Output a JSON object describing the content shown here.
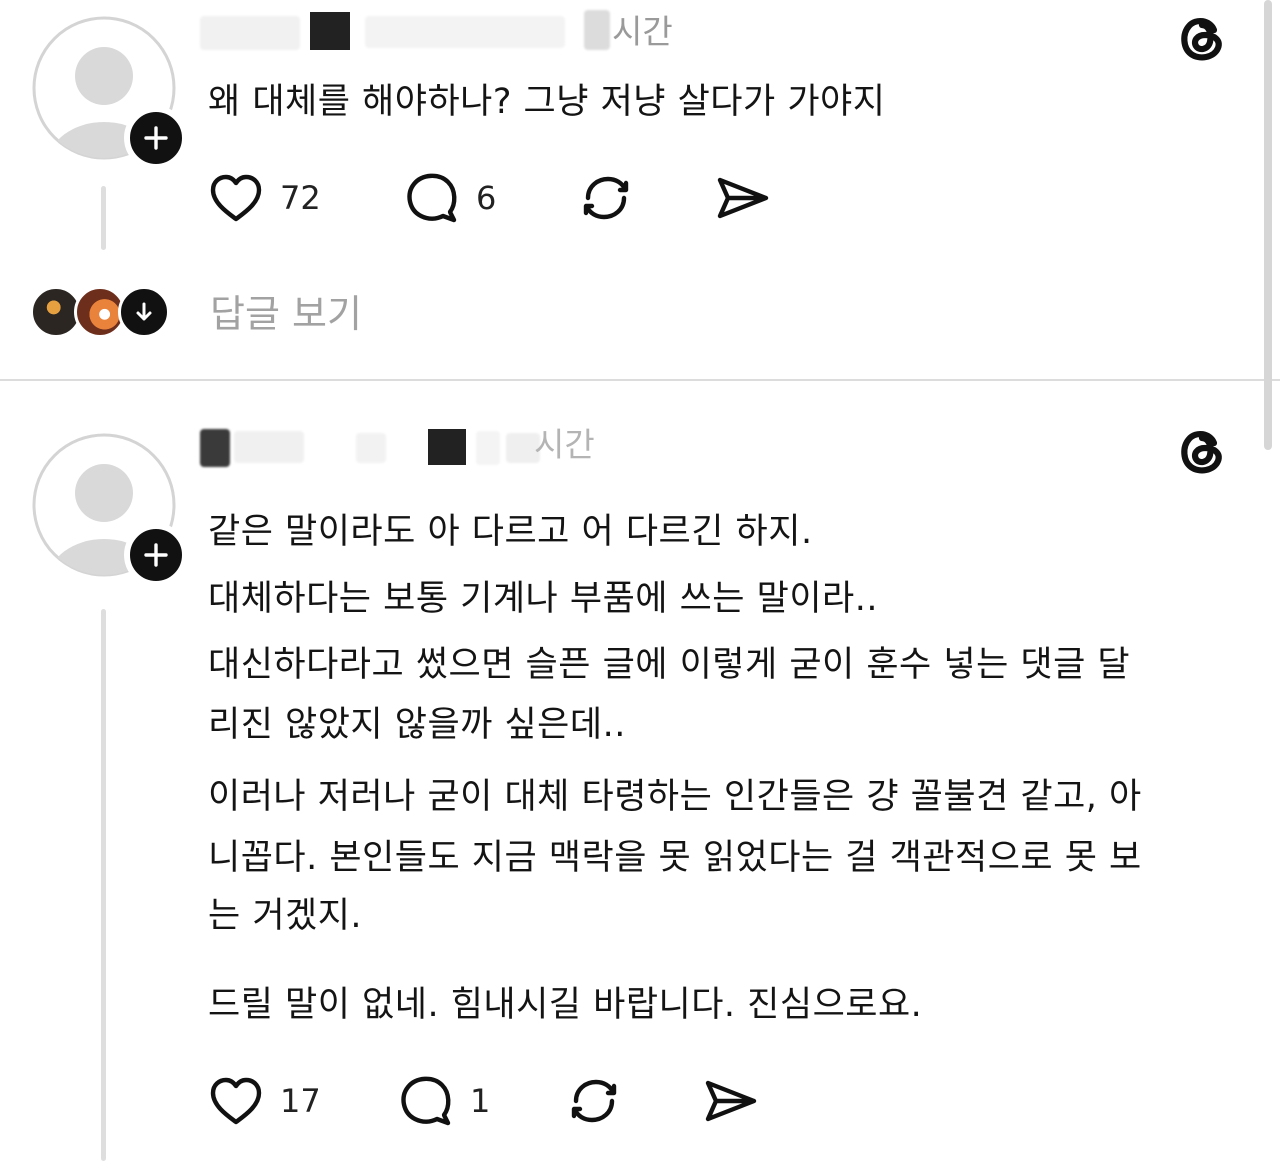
{
  "post_1": {
    "time": "시간",
    "text": "왜  대체를 해야하나?  그냥 저냥 살다가 가야지",
    "likes": "72",
    "comments": "6",
    "view_replies": "답글 보기"
  },
  "post_2": {
    "time": "시간",
    "paragraphs": [
      "같은 말이라도 아 다르고 어 다르긴 하지.",
      "대체하다는 보통 기계나 부품에 쓰는 말이라..",
      "대신하다라고 썼으면 슬픈 글에 이렇게 굳이 훈수 넣는 댓글 달",
      "리진 않았지 않을까 싶은데..",
      "이러나 저러나 굳이 대체 타령하는 인간들은 걍 꼴불견 같고, 아",
      "니꼽다. 본인들도 지금 맥락을 못 읽었다는 걸 객관적으로 못 보",
      "는 거겠지.",
      "드릴 말이 없네. 힘내시길 바랍니다. 진심으로요."
    ],
    "likes": "17",
    "comments": "1"
  },
  "icons": {
    "like": "heart-icon",
    "comment": "comment-bubble-icon",
    "repost": "repost-icon",
    "share": "send-icon",
    "follow": "plus-icon",
    "brand": "threads-logo-icon",
    "expand": "arrow-down-icon"
  },
  "colors": {
    "text": "#111111",
    "muted": "#9a9a9a",
    "divider": "#dcdcdc",
    "avatar_placeholder": "#d9d9d9"
  }
}
